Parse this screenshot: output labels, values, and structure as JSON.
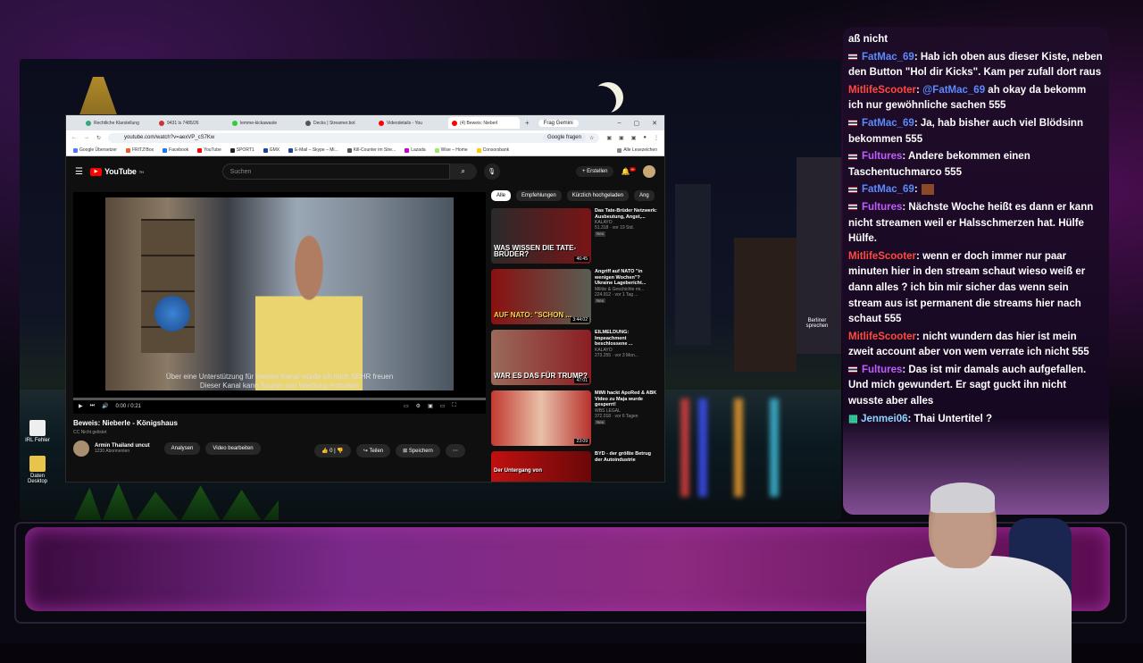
{
  "desktop": {
    "icons": [
      {
        "label": "IRL Fehler"
      },
      {
        "label": "Daten Desktop"
      }
    ]
  },
  "browser": {
    "tabs": [
      {
        "title": "Rechtliche Klarstellung"
      },
      {
        "title": "9431 ls 7485/26"
      },
      {
        "title": "lemme-kickawaste"
      },
      {
        "title": "Decks | Streamer.bot"
      },
      {
        "title": "Videodetails - You"
      },
      {
        "title": "(4) Beweis: Nieberl",
        "active": true
      }
    ],
    "new_tab": "+",
    "gemini": "Frag Gemini",
    "url": "youtube.com/watch?v=aexVP_cS7Kw",
    "google_ask": "Google fragen",
    "bookmarks": [
      "Google Übersetzer",
      "FRITZ!Box",
      "Facebook",
      "YouTube",
      "SPORT1",
      "GMX",
      "E-Mail – Skype – Mi...",
      "Kill-Counter im Stre...",
      "Lazada",
      "Wise – Home",
      "Consorsbank",
      "Alle Lesezeichen"
    ]
  },
  "youtube": {
    "logo": "YouTube",
    "logo_sup": "TH",
    "search_placeholder": "Suchen",
    "create_label": "Erstellen",
    "notif_count": "9+",
    "player": {
      "subtitle_line1": "Über eine Unterstützung für meinen Kanal würde ich mich SEHR freuen",
      "subtitle_line2": "Dieser Kanal kann Spuren von Werbung enthalten",
      "time": "0:00 / 0:21",
      "progress": 0
    },
    "video_title": "Beweis: Nieberle - Königshaus",
    "video_note": "CC Nicht gelistet",
    "channel_name": "Armin Thailand uncut",
    "channel_subs": "1230 Abonnenten",
    "btn_analysen": "Analysen",
    "btn_edit": "Video bearbeiten",
    "likes": "0",
    "btn_share": "Teilen",
    "btn_save": "Speichern",
    "chips": [
      "Alle",
      "Empfehlungen",
      "Kürzlich hochgeladen",
      "Ang"
    ],
    "recommendations": [
      {
        "thumb_text": "WAS WISSEN DIE TATE-BRÜDER?",
        "duration": "46:45",
        "title": "Das Tate-Brüder Netzwerk: Ausbeutung, Angst,...",
        "channel": "KALAYO",
        "meta": "51.318 · vor 19 Std.",
        "badge": "Neu",
        "color": "#7a1416"
      },
      {
        "thumb_text": "AUF NATO: \"SCHON ...",
        "duration": "3:44:02",
        "title": "Angriff auf NATO \"in wenigen Wochen\"? Ukraine Lagebericht...",
        "channel": "Militär & Geschichte mi...",
        "meta": "224.912 · vor 1 Tag ...",
        "badge": "Neu",
        "color": "#5a5e52"
      },
      {
        "thumb_text": "WAR ES DAS FÜR TRUMP?",
        "duration": "47:01",
        "title": "EILMELDUNG: Impeachment beschlossene ...",
        "channel": "KALAYO",
        "meta": "273.255 · vor 3 Mon...",
        "badge": "",
        "color": "#8a1e22"
      },
      {
        "thumb_text": "",
        "duration": "23:09",
        "title": "MiMi hackt ApoRed & ABK Video zu Maja wurde gesperrt!",
        "channel": "WBS LEGAL",
        "meta": "372.018 · vor 6 Tagen",
        "badge": "Neu",
        "color": "#b8312e"
      },
      {
        "thumb_text": "Der Untergang von",
        "duration": "",
        "title": "BYD - der größte Betrug der Autoindustrie",
        "channel": "",
        "meta": "",
        "badge": "",
        "color": "#9a1010"
      }
    ]
  },
  "scene": {
    "right_sign": "Berliner sprechen"
  },
  "chat": {
    "messages": [
      {
        "user": "",
        "color": "#ffffff",
        "text": "aß nicht",
        "flag": false
      },
      {
        "user": "FatMac_69",
        "color": "#5b8bff",
        "text": ": Hab ich oben aus dieser Kiste, neben den Button \"Hol dir Kicks\". Kam per zufall dort raus",
        "flag": true
      },
      {
        "user": "MitlifeScooter",
        "color": "#ff4a3d",
        "text": ": @FatMac_69 ah okay da bekomm ich nur gewöhnliche sachen 555",
        "flag": false,
        "mention": "@FatMac_69",
        "mention_color": "#5b8bff"
      },
      {
        "user": "FatMac_69",
        "color": "#5b8bff",
        "text": ": Ja, hab bisher auch viel Blödsinn bekommen 555",
        "flag": true
      },
      {
        "user": "Fultures",
        "color": "#c35cff",
        "text": ": Andere bekommen einen Taschentuchmarco 555",
        "flag": true
      },
      {
        "user": "FatMac_69",
        "color": "#5b8bff",
        "text": ":",
        "flag": true,
        "emote": true
      },
      {
        "user": "Fultures",
        "color": "#c35cff",
        "text": ": Nächste Woche heißt es dann er kann nicht streamen weil er Halsschmerzen hat. Hülfe Hülfe.",
        "flag": true
      },
      {
        "user": "MitlifeScooter",
        "color": "#ff4a3d",
        "text": ": wenn er doch immer nur paar minuten hier in den stream schaut wieso weiß er dann alles ? ich bin mir sicher das wenn sein stream aus ist permanent die streams hier nach schaut 555",
        "flag": false
      },
      {
        "user": "MitlifeScooter",
        "color": "#ff4a3d",
        "text": ": nicht wundern das hier ist mein zweit account aber von wem verrate ich nicht 555",
        "flag": false
      },
      {
        "user": "Fultures",
        "color": "#c35cff",
        "text": ": Das ist mir damals auch aufgefallen. Und mich gewundert. Er sagt guckt ihn nicht wusste aber alles",
        "flag": true
      },
      {
        "user": "Jenmei06",
        "color": "#8fd3ff",
        "text": ": Thai Untertitel ?",
        "flag": false,
        "badge_icon": true
      }
    ]
  },
  "colors": {
    "accent": "#ff0000",
    "chat_bg": "#1e0c28",
    "banner": "#8c2a80"
  }
}
